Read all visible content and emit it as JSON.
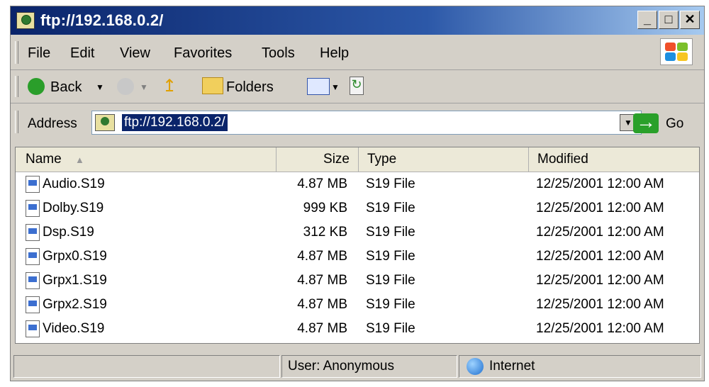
{
  "window": {
    "title": "ftp://192.168.0.2/"
  },
  "menu": [
    "File",
    "Edit",
    "View",
    "Favorites",
    "Tools",
    "Help"
  ],
  "toolbar": {
    "back_label": "Back",
    "folders_label": "Folders"
  },
  "address": {
    "label": "Address",
    "value": "ftp://192.168.0.2/",
    "go_label": "Go"
  },
  "columns": {
    "name": "Name",
    "size": "Size",
    "type": "Type",
    "modified": "Modified"
  },
  "files": [
    {
      "name": "Audio.S19",
      "size": "4.87 MB",
      "type": "S19 File",
      "modified": "12/25/2001 12:00 AM"
    },
    {
      "name": "Dolby.S19",
      "size": "999 KB",
      "type": "S19 File",
      "modified": "12/25/2001 12:00 AM"
    },
    {
      "name": "Dsp.S19",
      "size": "312 KB",
      "type": "S19 File",
      "modified": "12/25/2001 12:00 AM"
    },
    {
      "name": "Grpx0.S19",
      "size": "4.87 MB",
      "type": "S19 File",
      "modified": "12/25/2001 12:00 AM"
    },
    {
      "name": "Grpx1.S19",
      "size": "4.87 MB",
      "type": "S19 File",
      "modified": "12/25/2001 12:00 AM"
    },
    {
      "name": "Grpx2.S19",
      "size": "4.87 MB",
      "type": "S19 File",
      "modified": "12/25/2001 12:00 AM"
    },
    {
      "name": "Video.S19",
      "size": "4.87 MB",
      "type": "S19 File",
      "modified": "12/25/2001 12:00 AM"
    }
  ],
  "status": {
    "user": "User: Anonymous",
    "zone": "Internet"
  }
}
